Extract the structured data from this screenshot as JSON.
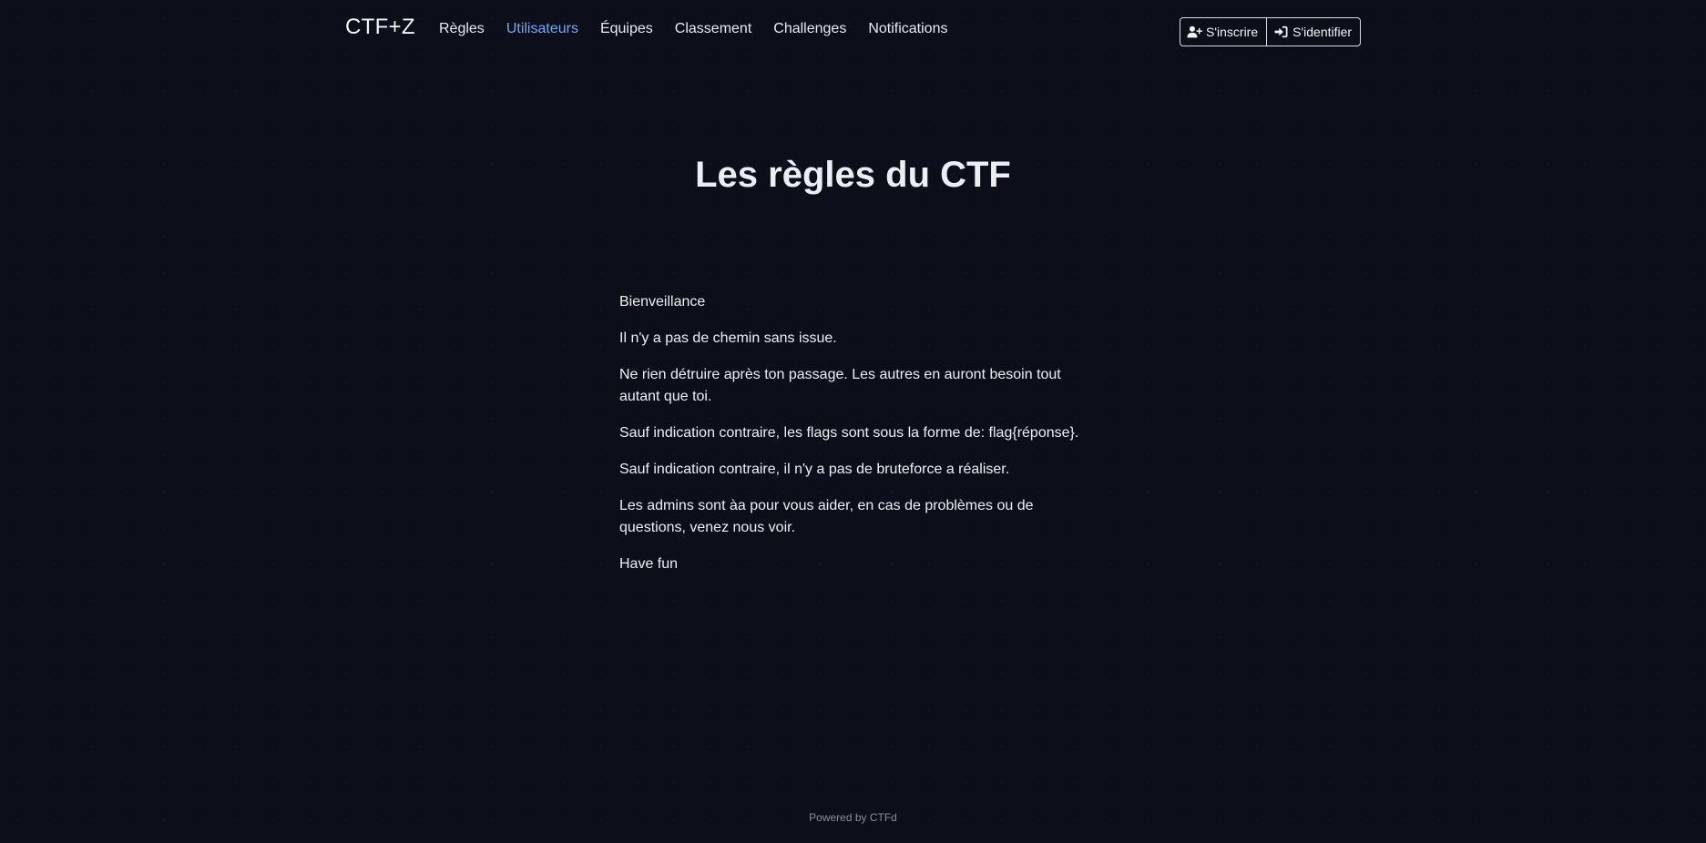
{
  "navbar": {
    "brand": "CTF+Z",
    "links": [
      {
        "label": "Règles",
        "active": false
      },
      {
        "label": "Utilisateurs",
        "active": true
      },
      {
        "label": "Équipes",
        "active": false
      },
      {
        "label": "Classement",
        "active": false
      },
      {
        "label": "Challenges",
        "active": false
      },
      {
        "label": "Notifications",
        "active": false
      }
    ],
    "register_label": "S'inscrire",
    "register_icon": "user-plus-icon",
    "login_label": "S'identifier",
    "login_icon": "sign-in-icon"
  },
  "page": {
    "title": "Les règles du CTF",
    "paragraphs": [
      "Bienveillance",
      "Il n'y a pas de chemin sans issue.",
      "Ne rien détruire après ton passage. Les autres en auront besoin tout autant que toi.",
      "Sauf indication contraire, les flags sont sous la forme de: flag{réponse}.",
      "Sauf indication contraire, il n'y a pas de bruteforce a réaliser.",
      "Les admins sont àa pour vous aider, en cas de problèmes ou de questions, venez nous voir.",
      "Have fun"
    ]
  },
  "footer": {
    "text": "Powered by CTFd"
  },
  "colors": {
    "background": "#0c0e19",
    "text": "#e6e8ef",
    "active_link": "#6ea8fe",
    "footer_text": "#8b8f9c"
  }
}
